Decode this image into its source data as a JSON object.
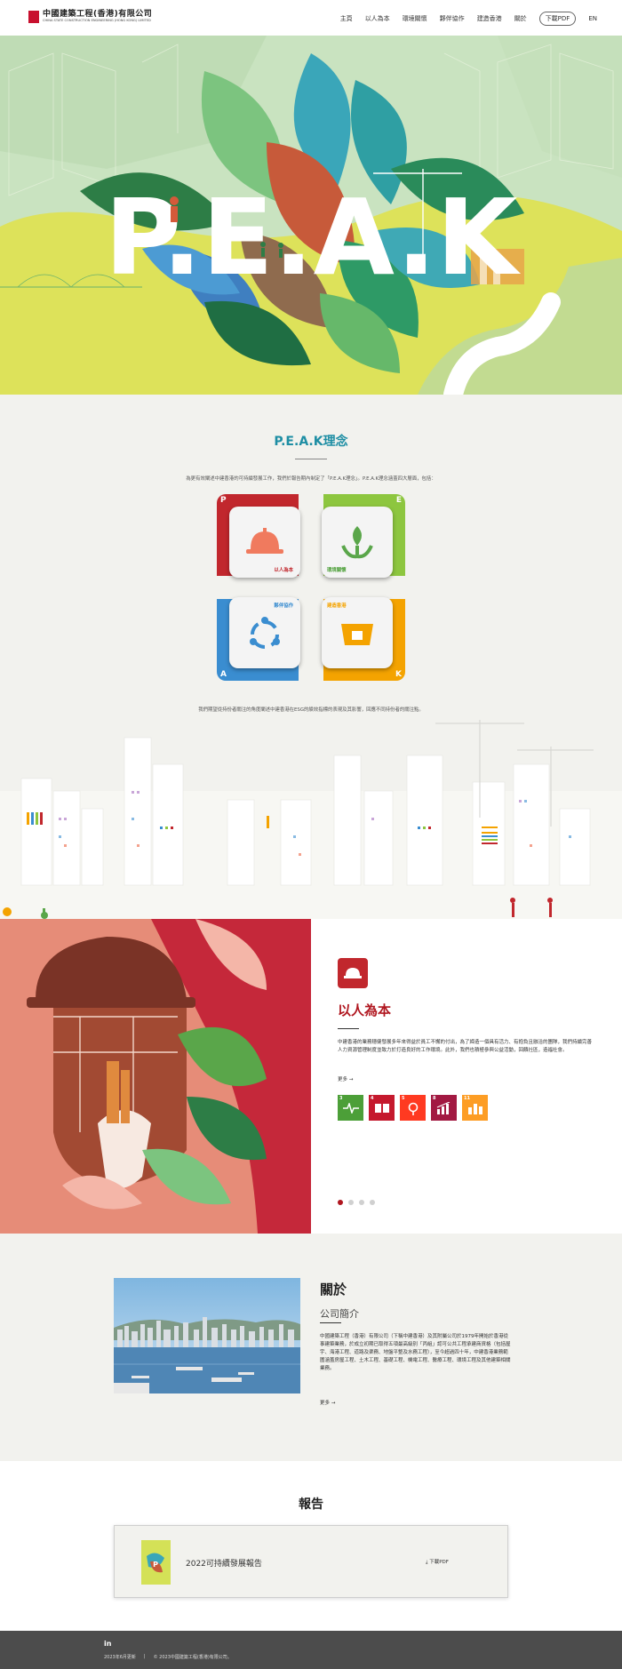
{
  "header": {
    "logo_cn": "中國建築工程(香港)有限公司",
    "logo_en": "CHINA STATE CONSTRUCTION ENGINEERING (HONG KONG) LIMITED",
    "nav": [
      "主頁",
      "以人為本",
      "環境關懷",
      "夥伴協作",
      "建造香港",
      "關於"
    ],
    "pdf_label": "下載PDF",
    "lang_label": "EN"
  },
  "hero": {
    "wordmark": "P.E.A.K"
  },
  "philosophy": {
    "title": "P.E.A.K理念",
    "intro": "為更有效闡述中建香港的可持續發展工作，我們於報告期內制定了「P.E.A.K理念」。P.E.A.K理念涵蓋四大層面，包括：",
    "pillars": [
      {
        "letter": "P",
        "label": "以人為本",
        "color": "#c1272d",
        "icon": "hard-hat-icon"
      },
      {
        "letter": "E",
        "label": "環境關懷",
        "color": "#8dc63f",
        "icon": "plant-hands-icon"
      },
      {
        "letter": "A",
        "label": "夥伴協作",
        "color": "#3a8dd0",
        "icon": "partnership-icon"
      },
      {
        "letter": "K",
        "label": "建造香港",
        "color": "#f4a300",
        "icon": "construction-icon"
      }
    ],
    "note": "我們期望從持份者關注的角度闡述中建香港在ESG的績效指標的表現及其影響，回應不同持份者的關注點。"
  },
  "people": {
    "title": "以人為本",
    "body": "中建香港的業務穩健發展多年來得益於員工不懈的付出，為了締造一個具有活力、有抱負且融洽的團隊，我們持續完善人力資源管理制度並致力於打造良好的工作環境。此外，我們也積極參與公益活動，回饋社區，造福社會。",
    "more_label": "更多",
    "sdgs": [
      {
        "num": "3",
        "color": "#4c9f38",
        "icon": "sdg-health-icon"
      },
      {
        "num": "4",
        "color": "#c5192d",
        "icon": "sdg-education-icon"
      },
      {
        "num": "5",
        "color": "#ff3a21",
        "icon": "sdg-gender-icon"
      },
      {
        "num": "8",
        "color": "#a21942",
        "icon": "sdg-growth-icon"
      },
      {
        "num": "11",
        "color": "#fd9d24",
        "icon": "sdg-cities-icon"
      }
    ],
    "slides": 4,
    "active_slide": 1
  },
  "about": {
    "title": "關於",
    "subtitle": "公司簡介",
    "body": "中國建築工程（香港）有限公司（下稱中建香港）及其附屬公司於1979年開始於香港從事建築業務，於成立初期已取得五項最高級別「丙組」認可公共工程承建商資格（包括屋宇、海港工程、道路及渠務、地盤平整及水務工程），至今超過四十年，中建香港業務範圍涵蓋房屋工程、土木工程、基礎工程、機電工程、醫療工程、環境工程及其他建築相關業務。",
    "more_label": "更多"
  },
  "report": {
    "title": "報告",
    "name": "2022可持續發展報告",
    "download_label": "下載PDF"
  },
  "footer": {
    "social": "in",
    "updated": "2023年6月更新",
    "copyright": "© 2023中國建築工程(香港)有限公司。"
  }
}
